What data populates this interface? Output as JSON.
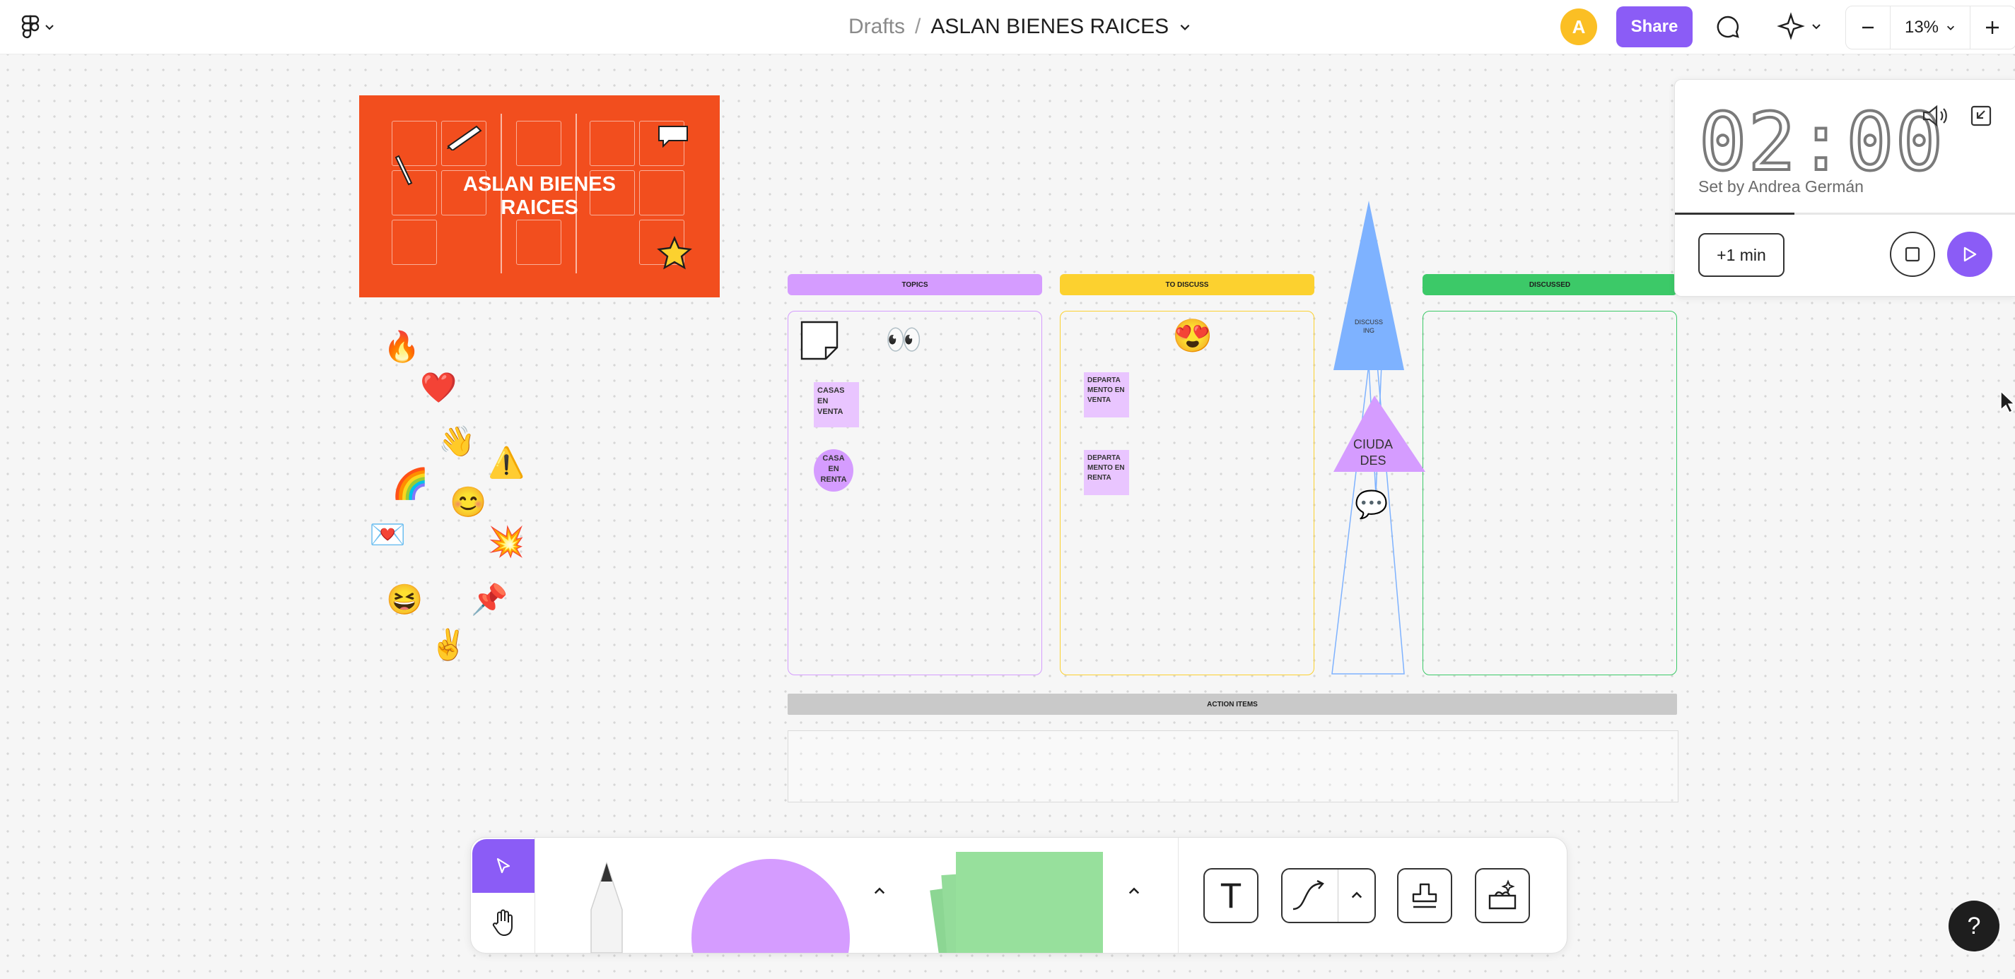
{
  "header": {
    "breadcrumb_parent": "Drafts",
    "separator": "/",
    "file_name": "ASLAN BIENES RAICES",
    "avatar_initial": "A",
    "share_label": "Share",
    "zoom_level": "13%",
    "zoom_out_symbol": "—",
    "zoom_in_symbol": "+"
  },
  "timer": {
    "display": "02:00",
    "set_by": "Set by Andrea Germán",
    "add_minute_label": "+1 min",
    "progress": 0.35
  },
  "canvas": {
    "banner_title_line1": "ASLAN BIENES",
    "banner_title_line2": "RAICES",
    "columns": {
      "topics": "TOPICS",
      "to_discuss": "TO DISCUSS",
      "discussing": "DISCUSS ING",
      "discussed": "DISCUSSED"
    },
    "action_items": "ACTION ITEMS",
    "stickies": {
      "casas_venta": "CASAS EN VENTA",
      "casa_renta": "CASA EN RENTA",
      "depto_venta": "DEPARTA MENTO EN VENTA",
      "depto_renta": "DEPARTA MENTO EN RENTA",
      "ciudades": "CIUDA DES"
    },
    "stickers": [
      "fire",
      "heart",
      "waving-hand",
      "warning",
      "rainbow-magic",
      "smiley",
      "love-letter",
      "wow",
      "grinning-face",
      "pushpin",
      "peace-hand",
      "eyes",
      "heart-eyes",
      "chat-at",
      "star",
      "pencil",
      "done-bubble"
    ]
  },
  "toolbar": {
    "tools": [
      "move",
      "hand",
      "pencil",
      "shape",
      "sticky-note",
      "text",
      "connector",
      "stamp",
      "widgets"
    ],
    "text_tool_glyph": "T"
  },
  "help_label": "?",
  "colors": {
    "accent": "#8b5cf6",
    "banner": "#f24e1e",
    "topics": "#d59cff",
    "to_discuss": "#fcd12f",
    "discussing": "#7eb2ff",
    "discussed": "#3cc968",
    "action_items": "#c9c9c9"
  }
}
